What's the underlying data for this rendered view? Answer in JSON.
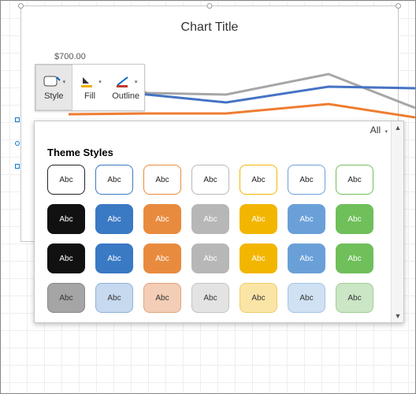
{
  "chart": {
    "title": "Chart Title",
    "axis_value": "$700.00"
  },
  "toolbar": {
    "style": "Style",
    "fill": "Fill",
    "outline": "Outline"
  },
  "gallery": {
    "filter": "All",
    "section_title": "Theme Styles",
    "swatch_text": "Abc"
  },
  "swatches": {
    "row1": [
      {
        "bg": "#ffffff",
        "border": "#222",
        "fg": "#222"
      },
      {
        "bg": "#ffffff",
        "border": "#3a79c4",
        "fg": "#222"
      },
      {
        "bg": "#ffffff",
        "border": "#e88b3e",
        "fg": "#222"
      },
      {
        "bg": "#ffffff",
        "border": "#b7b7b7",
        "fg": "#222"
      },
      {
        "bg": "#ffffff",
        "border": "#f2b600",
        "fg": "#222"
      },
      {
        "bg": "#ffffff",
        "border": "#6aa0d8",
        "fg": "#222"
      },
      {
        "bg": "#ffffff",
        "border": "#6fbf5a",
        "fg": "#222"
      }
    ],
    "row2": [
      {
        "bg": "#111111",
        "border": "#111",
        "fg": "#fff"
      },
      {
        "bg": "#3a79c4",
        "border": "#3a79c4",
        "fg": "#fff"
      },
      {
        "bg": "#e88b3e",
        "border": "#e88b3e",
        "fg": "#fff"
      },
      {
        "bg": "#b7b7b7",
        "border": "#b7b7b7",
        "fg": "#fff"
      },
      {
        "bg": "#f2b600",
        "border": "#f2b600",
        "fg": "#fff"
      },
      {
        "bg": "#6aa0d8",
        "border": "#6aa0d8",
        "fg": "#fff"
      },
      {
        "bg": "#6fbf5a",
        "border": "#6fbf5a",
        "fg": "#fff"
      }
    ],
    "row3": [
      {
        "bg": "#111111",
        "border": "#111",
        "fg": "#fff"
      },
      {
        "bg": "#3a79c4",
        "border": "#3a79c4",
        "fg": "#fff"
      },
      {
        "bg": "#e88b3e",
        "border": "#e88b3e",
        "fg": "#fff"
      },
      {
        "bg": "#b7b7b7",
        "border": "#b7b7b7",
        "fg": "#fff"
      },
      {
        "bg": "#f2b600",
        "border": "#f2b600",
        "fg": "#fff"
      },
      {
        "bg": "#6aa0d8",
        "border": "#6aa0d8",
        "fg": "#fff"
      },
      {
        "bg": "#6fbf5a",
        "border": "#6fbf5a",
        "fg": "#fff"
      }
    ],
    "row4": [
      {
        "bg": "#a5a5a5",
        "border": "#888",
        "fg": "#333"
      },
      {
        "bg": "#c6d9ee",
        "border": "#8fb2da",
        "fg": "#333"
      },
      {
        "bg": "#f3cdb6",
        "border": "#e2a37a",
        "fg": "#333"
      },
      {
        "bg": "#e3e3e3",
        "border": "#c2c2c2",
        "fg": "#333"
      },
      {
        "bg": "#fbe5a6",
        "border": "#efcd6a",
        "fg": "#333"
      },
      {
        "bg": "#cfe1f2",
        "border": "#a4c5e5",
        "fg": "#333"
      },
      {
        "bg": "#cbe6c5",
        "border": "#9fce95",
        "fg": "#333"
      }
    ]
  }
}
